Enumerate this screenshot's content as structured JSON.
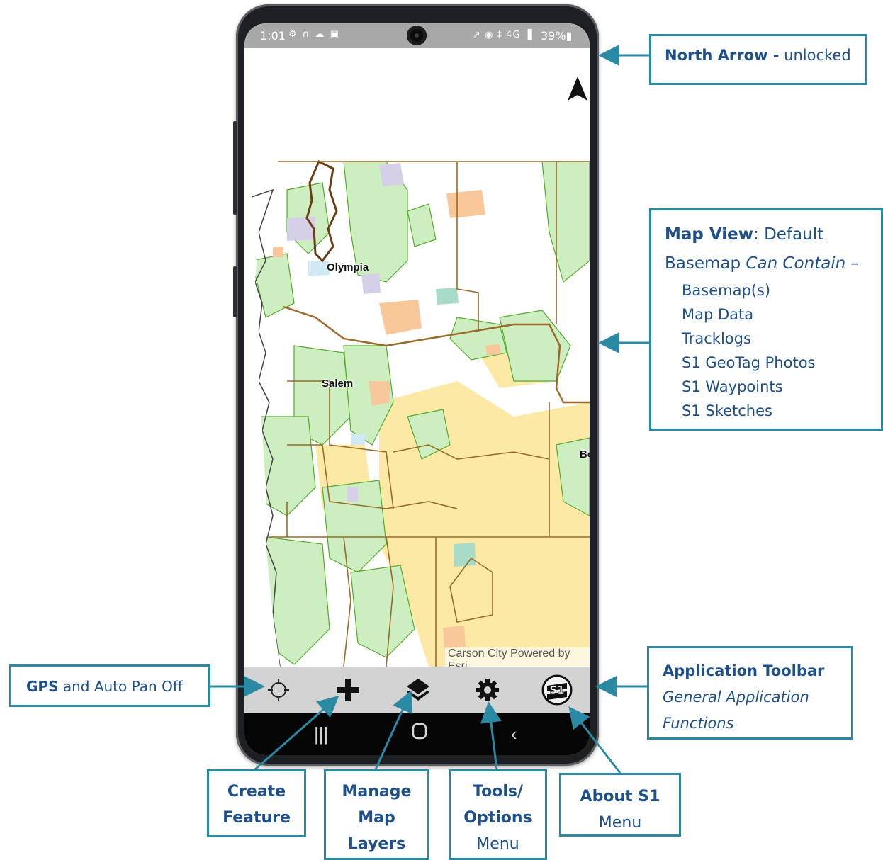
{
  "status_bar": {
    "time": "1:01",
    "left_icons": "⚙ ∩ ☁ ▣",
    "right_icons": "↗ ◉ ‡ 4G ▐",
    "battery": "39%"
  },
  "map": {
    "labels": {
      "olympia": "Olympia",
      "salem": "Salem",
      "edge": "Bo"
    },
    "attribution_left": "Carson City",
    "attribution_right": "Powered by Esri",
    "colors": {
      "forest": "#cdeec0",
      "forest_border": "#55aa2a",
      "boundary": "#9a6a26",
      "blm": "#fde9a6",
      "orange": "#f8c79a",
      "lavender": "#d6cfe8",
      "water": "#cfeaf5",
      "teal": "#a8dcc8"
    }
  },
  "toolbar": {
    "items": [
      {
        "name": "gps",
        "icon": "crosshair-icon"
      },
      {
        "name": "create",
        "icon": "plus-icon"
      },
      {
        "name": "layers",
        "icon": "layers-icon"
      },
      {
        "name": "tools",
        "icon": "gear-icon"
      },
      {
        "name": "about",
        "icon": "s1-logo-icon"
      }
    ]
  },
  "callouts": {
    "north_arrow": {
      "title": "North Arrow -",
      "text": "unlocked"
    },
    "map_view": {
      "title": "Map View",
      "title_rest": ": Default",
      "line2_a": "Basemap ",
      "line2_b": "Can Contain",
      "line2_c": " –",
      "items": [
        "Basemap(s)",
        "Map Data",
        "Tracklogs",
        "S1 GeoTag Photos",
        "S1 Waypoints",
        "S1 Sketches"
      ]
    },
    "gps": {
      "title": "GPS",
      "text": " and Auto Pan Off"
    },
    "app_toolbar": {
      "title": "Application Toolbar",
      "line2": "General Application",
      "line3": "Functions"
    },
    "create": {
      "line1": "Create",
      "line2": "Feature"
    },
    "layers": {
      "line1": "Manage",
      "line2": "Map",
      "line3": "Layers"
    },
    "tools": {
      "line1": "Tools/",
      "line2": "Options",
      "line3": "Menu"
    },
    "about": {
      "line1": "About S1",
      "line2": "Menu"
    }
  },
  "accent_color": "#2a8aa3",
  "text_color": "#1d4f8c"
}
